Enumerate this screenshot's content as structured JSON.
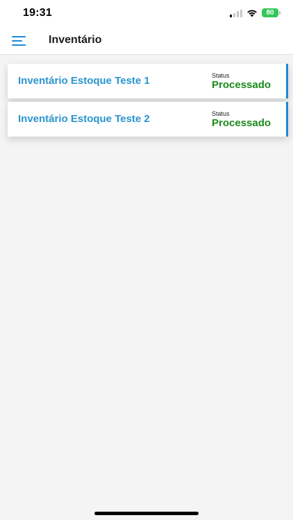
{
  "status_bar": {
    "time": "19:31",
    "battery": "80"
  },
  "header": {
    "title": "Inventário"
  },
  "inventories": [
    {
      "title": "Inventário Estoque Teste 1",
      "status_label": "Status",
      "status": "Processado"
    },
    {
      "title": "Inventário Estoque Teste 2",
      "status_label": "Status",
      "status": "Processado"
    }
  ],
  "colors": {
    "accent": "#1e88d6",
    "title": "#2b94cf",
    "status_ok": "#1a8a1a",
    "background": "#f4f4f5"
  },
  "icons": {
    "menu": "hamburger-menu-icon",
    "signal": "cellular-signal-icon",
    "wifi": "wifi-icon",
    "battery": "battery-charging-icon"
  }
}
